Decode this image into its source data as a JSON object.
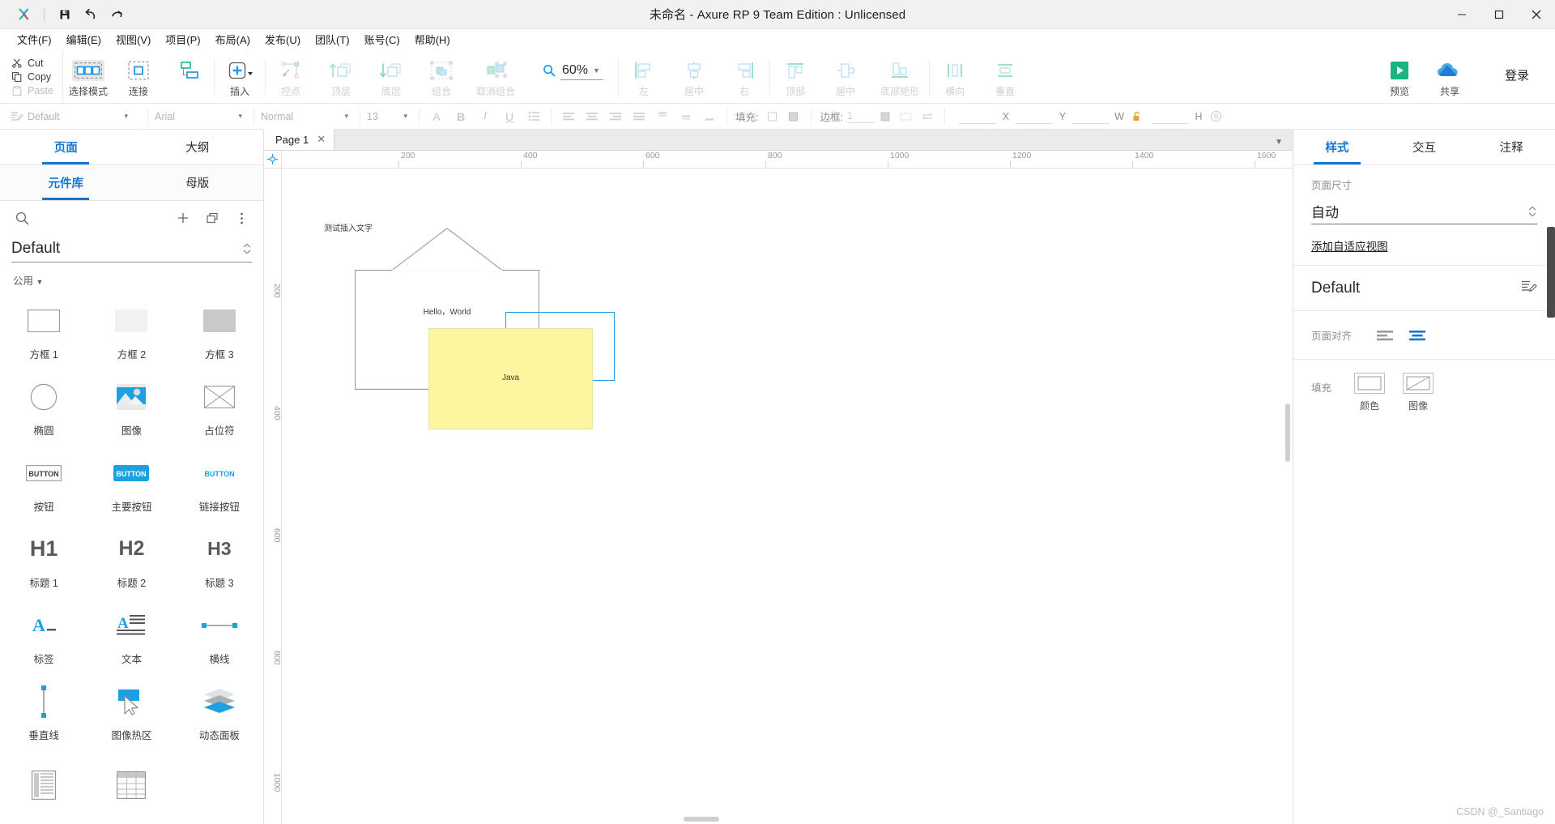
{
  "window": {
    "title": "未命名 - Axure RP 9 Team Edition : Unlicensed",
    "minimize": "—",
    "maximize": "▢",
    "close": "✕",
    "quick_actions": [
      "save-icon",
      "undo-icon",
      "redo-icon"
    ]
  },
  "menubar": [
    {
      "label": "文件(F)",
      "key": "F"
    },
    {
      "label": "编辑(E)",
      "key": "E"
    },
    {
      "label": "视图(V)",
      "key": "V"
    },
    {
      "label": "项目(P)",
      "key": "P"
    },
    {
      "label": "布局(A)",
      "key": "A"
    },
    {
      "label": "发布(U)",
      "key": "U"
    },
    {
      "label": "团队(T)",
      "key": "T"
    },
    {
      "label": "账号(C)",
      "key": "C"
    },
    {
      "label": "帮助(H)",
      "key": "H"
    }
  ],
  "clipboard": {
    "cut": "Cut",
    "copy": "Copy",
    "paste": "Paste"
  },
  "toolbar": {
    "groups": [
      {
        "buttons": [
          {
            "label": "选择模式",
            "icon": "select-mode-icon",
            "disabled": false,
            "active": true
          },
          {
            "label": "连接",
            "icon": "connect-icon",
            "disabled": false,
            "active": false
          }
        ]
      },
      {
        "buttons": [
          {
            "label": "插入",
            "icon": "insert-plus-icon",
            "disabled": false,
            "active": false,
            "has_caret": true
          }
        ]
      },
      {
        "buttons": [
          {
            "label": "控点",
            "icon": "control-point-icon",
            "disabled": true,
            "active": false
          },
          {
            "label": "顶层",
            "icon": "bring-to-front-icon",
            "disabled": true,
            "active": false
          },
          {
            "label": "底层",
            "icon": "send-to-back-icon",
            "disabled": true,
            "active": false
          },
          {
            "label": "组合",
            "icon": "group-icon",
            "disabled": true,
            "active": false
          },
          {
            "label": "取消组合",
            "icon": "ungroup-icon",
            "disabled": true,
            "active": false
          }
        ]
      },
      {
        "buttons": [
          {
            "label": "左",
            "icon": "align-left-icon",
            "disabled": true,
            "active": false
          },
          {
            "label": "居中",
            "icon": "align-center-icon",
            "disabled": true,
            "active": false
          },
          {
            "label": "右",
            "icon": "align-right-icon",
            "disabled": true,
            "active": false
          }
        ]
      },
      {
        "buttons": [
          {
            "label": "顶部",
            "icon": "align-top-icon",
            "disabled": true,
            "active": false
          },
          {
            "label": "居中",
            "icon": "align-middle-icon",
            "disabled": true,
            "active": false
          },
          {
            "label": "底部矩形",
            "icon": "align-bottom-icon",
            "disabled": true,
            "active": false
          }
        ]
      },
      {
        "buttons": [
          {
            "label": "横向",
            "icon": "distribute-horizontal-icon",
            "disabled": true,
            "active": false
          },
          {
            "label": "垂直",
            "icon": "distribute-vertical-icon",
            "disabled": true,
            "active": false
          }
        ]
      }
    ],
    "zoom": {
      "value": "60%",
      "icon": "zoom-search-icon"
    },
    "preview": {
      "label": "预览",
      "icon": "preview-play-icon",
      "color": "#18b57f"
    },
    "share": {
      "label": "共享",
      "icon": "share-cloud-icon",
      "color": "#1e90e8"
    },
    "login": "登录"
  },
  "format": {
    "style_select": "Default",
    "font_family": "Arial",
    "font_weight": "Normal",
    "font_size": "13",
    "text_color_icon": "font-color-icon",
    "bold": "B",
    "italic": "I",
    "underline": "U",
    "list": "bullet-list-icon",
    "align_icons": [
      "align-left-icon",
      "align-center-icon",
      "align-right-icon",
      "align-justify-icon"
    ],
    "valign_icons": [
      "valign-top-icon",
      "valign-middle-icon",
      "valign-bottom-icon"
    ],
    "fill_label": "填充:",
    "border_label": "边框:",
    "border_width": "1",
    "coords": {
      "x": "X",
      "y": "Y",
      "w": "W",
      "h": "H"
    },
    "lock_icon": "lock-open-icon",
    "eye_icon": "visibility-icon"
  },
  "left_panel": {
    "top_tabs": [
      {
        "label": "页面",
        "active": true
      },
      {
        "label": "大纲",
        "active": false
      }
    ],
    "lib_tabs": [
      {
        "label": "元件库",
        "active": true
      },
      {
        "label": "母版",
        "active": false
      }
    ],
    "search_icon": "search-icon",
    "add_icon": "plus-icon",
    "copy_icon": "duplicate-icon",
    "more_icon": "more-vertical-icon",
    "library_name": "Default",
    "group_label": "公用",
    "widgets": [
      {
        "label": "方框 1",
        "icon": "box-outline-icon"
      },
      {
        "label": "方框 2",
        "icon": "box-light-icon"
      },
      {
        "label": "方框 3",
        "icon": "box-gray-icon"
      },
      {
        "label": "椭圆",
        "icon": "ellipse-icon"
      },
      {
        "label": "图像",
        "icon": "image-icon"
      },
      {
        "label": "占位符",
        "icon": "placeholder-icon"
      },
      {
        "label": "按钮",
        "icon": "button-icon"
      },
      {
        "label": "主要按钮",
        "icon": "primary-button-icon"
      },
      {
        "label": "链接按钮",
        "icon": "link-button-icon"
      },
      {
        "label": "标题 1",
        "icon": "h1-icon",
        "glyph": "H1"
      },
      {
        "label": "标题 2",
        "icon": "h2-icon",
        "glyph": "H2"
      },
      {
        "label": "标题 3",
        "icon": "h3-icon",
        "glyph": "H3"
      },
      {
        "label": "标签",
        "icon": "label-icon"
      },
      {
        "label": "文本",
        "icon": "text-paragraph-icon"
      },
      {
        "label": "横线",
        "icon": "horizontal-line-icon"
      },
      {
        "label": "垂直线",
        "icon": "vertical-line-icon"
      },
      {
        "label": "图像热区",
        "icon": "hotspot-icon"
      },
      {
        "label": "动态面板",
        "icon": "dynamic-panel-icon"
      },
      {
        "label": "",
        "icon": "inline-frame-icon"
      },
      {
        "label": "",
        "icon": "table-icon"
      }
    ]
  },
  "canvas": {
    "page_tab": {
      "label": "Page 1",
      "close": "✕"
    },
    "h_ruler_ticks": [
      "200",
      "400",
      "600",
      "800",
      "1000",
      "1200",
      "1400",
      "1600"
    ],
    "v_ruler_ticks": [
      "200",
      "400",
      "600",
      "800",
      "1000"
    ],
    "objects": [
      {
        "type": "text",
        "text": "测试插入文字"
      },
      {
        "type": "house-shape",
        "text": "Hello，World"
      },
      {
        "type": "rect-yellow",
        "text": "Java"
      },
      {
        "type": "selection-rect",
        "text": ""
      }
    ]
  },
  "right_panel": {
    "tabs": [
      {
        "label": "样式",
        "active": true
      },
      {
        "label": "交互",
        "active": false
      },
      {
        "label": "注释",
        "active": false
      }
    ],
    "page_size_label": "页面尺寸",
    "page_size_value": "自动",
    "adaptive_link": "添加自适应视图",
    "style_name": "Default",
    "style_edit_icon": "edit-style-icon",
    "page_align_label": "页面对齐",
    "align_left_icon": "page-align-left-icon",
    "align_center_icon": "page-align-center-icon",
    "fill_label": "填充",
    "fill_options": [
      {
        "label": "颜色",
        "icon": "fill-color-icon"
      },
      {
        "label": "图像",
        "icon": "fill-image-icon"
      }
    ]
  },
  "watermark": "CSDN @_Santiago",
  "colors": {
    "accent": "#1675d1",
    "blue": "#1d9bf0",
    "green": "#18b57f",
    "yellow": "#fdf59f"
  }
}
